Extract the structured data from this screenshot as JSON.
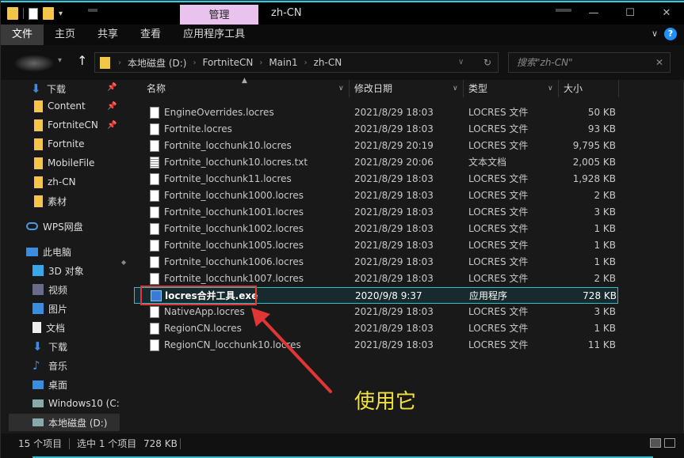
{
  "window": {
    "context_tab": "管理",
    "title": "zh-CN",
    "controls": [
      "—",
      "☐",
      "✕"
    ]
  },
  "ribbon": {
    "tabs": [
      "文件",
      "主页",
      "共享",
      "查看",
      "应用程序工具"
    ],
    "active_tab": "文件",
    "help_label": "?"
  },
  "address": {
    "breadcrumbs": [
      "本地磁盘 (D:)",
      "FortniteCN",
      "Main1",
      "zh-CN"
    ],
    "search_placeholder": "搜索\"zh-CN\""
  },
  "nav": {
    "quick_access": [
      {
        "label": "下载",
        "icon": "download-arrow-icon",
        "pinned": true
      },
      {
        "label": "Content",
        "icon": "folder-icon",
        "pinned": true
      },
      {
        "label": "FortniteCN",
        "icon": "folder-icon",
        "pinned": true
      },
      {
        "label": "Fortnite",
        "icon": "folder-icon",
        "pinned": false
      },
      {
        "label": "MobileFile",
        "icon": "folder-icon",
        "pinned": false
      },
      {
        "label": "zh-CN",
        "icon": "folder-icon",
        "pinned": false
      },
      {
        "label": "素材",
        "icon": "folder-icon",
        "pinned": false
      }
    ],
    "wps": "WPS网盘",
    "this_pc": "此电脑",
    "pc_items": [
      {
        "label": "3D 对象",
        "icon": "cube-icon"
      },
      {
        "label": "视频",
        "icon": "video-icon"
      },
      {
        "label": "图片",
        "icon": "picture-icon"
      },
      {
        "label": "文档",
        "icon": "document-icon"
      },
      {
        "label": "下载",
        "icon": "download-arrow-icon"
      },
      {
        "label": "音乐",
        "icon": "music-icon"
      },
      {
        "label": "桌面",
        "icon": "desktop-icon"
      },
      {
        "label": "Windows10 (C:",
        "icon": "drive-icon"
      },
      {
        "label": "本地磁盘 (D:)",
        "icon": "drive-icon"
      }
    ]
  },
  "columns": {
    "name": "名称",
    "date": "修改日期",
    "type": "类型",
    "size": "大小"
  },
  "files": [
    {
      "name": "EngineOverrides.locres",
      "date": "2021/8/29 18:03",
      "type": "LOCRES 文件",
      "size": "50 KB",
      "icon": "file-icon"
    },
    {
      "name": "Fortnite.locres",
      "date": "2021/8/29 18:03",
      "type": "LOCRES 文件",
      "size": "93 KB",
      "icon": "file-icon"
    },
    {
      "name": "Fortnite_locchunk10.locres",
      "date": "2021/8/29 20:19",
      "type": "LOCRES 文件",
      "size": "9,795 KB",
      "icon": "file-icon"
    },
    {
      "name": "Fortnite_locchunk10.locres.txt",
      "date": "2021/8/29 20:06",
      "type": "文本文档",
      "size": "2,005 KB",
      "icon": "text-file-icon"
    },
    {
      "name": "Fortnite_locchunk11.locres",
      "date": "2021/8/29 18:03",
      "type": "LOCRES 文件",
      "size": "1,928 KB",
      "icon": "file-icon"
    },
    {
      "name": "Fortnite_locchunk1000.locres",
      "date": "2021/8/29 18:03",
      "type": "LOCRES 文件",
      "size": "2 KB",
      "icon": "file-icon"
    },
    {
      "name": "Fortnite_locchunk1001.locres",
      "date": "2021/8/29 18:03",
      "type": "LOCRES 文件",
      "size": "3 KB",
      "icon": "file-icon"
    },
    {
      "name": "Fortnite_locchunk1002.locres",
      "date": "2021/8/29 18:03",
      "type": "LOCRES 文件",
      "size": "1 KB",
      "icon": "file-icon"
    },
    {
      "name": "Fortnite_locchunk1005.locres",
      "date": "2021/8/29 18:03",
      "type": "LOCRES 文件",
      "size": "1 KB",
      "icon": "file-icon"
    },
    {
      "name": "Fortnite_locchunk1006.locres",
      "date": "2021/8/29 18:03",
      "type": "LOCRES 文件",
      "size": "1 KB",
      "icon": "file-icon"
    },
    {
      "name": "Fortnite_locchunk1007.locres",
      "date": "2021/8/29 18:03",
      "type": "LOCRES 文件",
      "size": "2 KB",
      "icon": "file-icon"
    },
    {
      "name": "locres合并工具.exe",
      "date": "2020/9/8 9:37",
      "type": "应用程序",
      "size": "728 KB",
      "icon": "exe-icon",
      "selected": true
    },
    {
      "name": "NativeApp.locres",
      "date": "2021/8/29 18:03",
      "type": "LOCRES 文件",
      "size": "3 KB",
      "icon": "file-icon"
    },
    {
      "name": "RegionCN.locres",
      "date": "2021/8/29 18:03",
      "type": "LOCRES 文件",
      "size": "1 KB",
      "icon": "file-icon"
    },
    {
      "name": "RegionCN_locchunk10.locres",
      "date": "2021/8/29 18:03",
      "type": "LOCRES 文件",
      "size": "11 KB",
      "icon": "file-icon"
    }
  ],
  "annotation": {
    "text": "使用它",
    "box_color": "#e23535",
    "text_color": "#f1e23a"
  },
  "status": {
    "count": "15 个项目",
    "selected": "选中 1 个项目",
    "selected_size": "728 KB"
  },
  "colors": {
    "accent": "#29d0e8",
    "context_tab": "#e9c2ee",
    "folder": "#f3c64a",
    "selection_border": "#2ac0c8"
  }
}
